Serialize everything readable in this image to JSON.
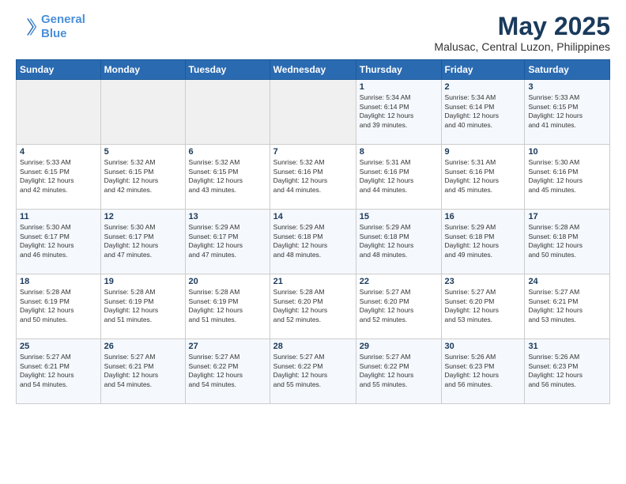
{
  "header": {
    "logo_line1": "General",
    "logo_line2": "Blue",
    "title": "May 2025",
    "subtitle": "Malusac, Central Luzon, Philippines"
  },
  "weekdays": [
    "Sunday",
    "Monday",
    "Tuesday",
    "Wednesday",
    "Thursday",
    "Friday",
    "Saturday"
  ],
  "weeks": [
    [
      {
        "day": "",
        "info": ""
      },
      {
        "day": "",
        "info": ""
      },
      {
        "day": "",
        "info": ""
      },
      {
        "day": "",
        "info": ""
      },
      {
        "day": "1",
        "info": "Sunrise: 5:34 AM\nSunset: 6:14 PM\nDaylight: 12 hours\nand 39 minutes."
      },
      {
        "day": "2",
        "info": "Sunrise: 5:34 AM\nSunset: 6:14 PM\nDaylight: 12 hours\nand 40 minutes."
      },
      {
        "day": "3",
        "info": "Sunrise: 5:33 AM\nSunset: 6:15 PM\nDaylight: 12 hours\nand 41 minutes."
      }
    ],
    [
      {
        "day": "4",
        "info": "Sunrise: 5:33 AM\nSunset: 6:15 PM\nDaylight: 12 hours\nand 42 minutes."
      },
      {
        "day": "5",
        "info": "Sunrise: 5:32 AM\nSunset: 6:15 PM\nDaylight: 12 hours\nand 42 minutes."
      },
      {
        "day": "6",
        "info": "Sunrise: 5:32 AM\nSunset: 6:15 PM\nDaylight: 12 hours\nand 43 minutes."
      },
      {
        "day": "7",
        "info": "Sunrise: 5:32 AM\nSunset: 6:16 PM\nDaylight: 12 hours\nand 44 minutes."
      },
      {
        "day": "8",
        "info": "Sunrise: 5:31 AM\nSunset: 6:16 PM\nDaylight: 12 hours\nand 44 minutes."
      },
      {
        "day": "9",
        "info": "Sunrise: 5:31 AM\nSunset: 6:16 PM\nDaylight: 12 hours\nand 45 minutes."
      },
      {
        "day": "10",
        "info": "Sunrise: 5:30 AM\nSunset: 6:16 PM\nDaylight: 12 hours\nand 45 minutes."
      }
    ],
    [
      {
        "day": "11",
        "info": "Sunrise: 5:30 AM\nSunset: 6:17 PM\nDaylight: 12 hours\nand 46 minutes."
      },
      {
        "day": "12",
        "info": "Sunrise: 5:30 AM\nSunset: 6:17 PM\nDaylight: 12 hours\nand 47 minutes."
      },
      {
        "day": "13",
        "info": "Sunrise: 5:29 AM\nSunset: 6:17 PM\nDaylight: 12 hours\nand 47 minutes."
      },
      {
        "day": "14",
        "info": "Sunrise: 5:29 AM\nSunset: 6:18 PM\nDaylight: 12 hours\nand 48 minutes."
      },
      {
        "day": "15",
        "info": "Sunrise: 5:29 AM\nSunset: 6:18 PM\nDaylight: 12 hours\nand 48 minutes."
      },
      {
        "day": "16",
        "info": "Sunrise: 5:29 AM\nSunset: 6:18 PM\nDaylight: 12 hours\nand 49 minutes."
      },
      {
        "day": "17",
        "info": "Sunrise: 5:28 AM\nSunset: 6:18 PM\nDaylight: 12 hours\nand 50 minutes."
      }
    ],
    [
      {
        "day": "18",
        "info": "Sunrise: 5:28 AM\nSunset: 6:19 PM\nDaylight: 12 hours\nand 50 minutes."
      },
      {
        "day": "19",
        "info": "Sunrise: 5:28 AM\nSunset: 6:19 PM\nDaylight: 12 hours\nand 51 minutes."
      },
      {
        "day": "20",
        "info": "Sunrise: 5:28 AM\nSunset: 6:19 PM\nDaylight: 12 hours\nand 51 minutes."
      },
      {
        "day": "21",
        "info": "Sunrise: 5:28 AM\nSunset: 6:20 PM\nDaylight: 12 hours\nand 52 minutes."
      },
      {
        "day": "22",
        "info": "Sunrise: 5:27 AM\nSunset: 6:20 PM\nDaylight: 12 hours\nand 52 minutes."
      },
      {
        "day": "23",
        "info": "Sunrise: 5:27 AM\nSunset: 6:20 PM\nDaylight: 12 hours\nand 53 minutes."
      },
      {
        "day": "24",
        "info": "Sunrise: 5:27 AM\nSunset: 6:21 PM\nDaylight: 12 hours\nand 53 minutes."
      }
    ],
    [
      {
        "day": "25",
        "info": "Sunrise: 5:27 AM\nSunset: 6:21 PM\nDaylight: 12 hours\nand 54 minutes."
      },
      {
        "day": "26",
        "info": "Sunrise: 5:27 AM\nSunset: 6:21 PM\nDaylight: 12 hours\nand 54 minutes."
      },
      {
        "day": "27",
        "info": "Sunrise: 5:27 AM\nSunset: 6:22 PM\nDaylight: 12 hours\nand 54 minutes."
      },
      {
        "day": "28",
        "info": "Sunrise: 5:27 AM\nSunset: 6:22 PM\nDaylight: 12 hours\nand 55 minutes."
      },
      {
        "day": "29",
        "info": "Sunrise: 5:27 AM\nSunset: 6:22 PM\nDaylight: 12 hours\nand 55 minutes."
      },
      {
        "day": "30",
        "info": "Sunrise: 5:26 AM\nSunset: 6:23 PM\nDaylight: 12 hours\nand 56 minutes."
      },
      {
        "day": "31",
        "info": "Sunrise: 5:26 AM\nSunset: 6:23 PM\nDaylight: 12 hours\nand 56 minutes."
      }
    ]
  ]
}
